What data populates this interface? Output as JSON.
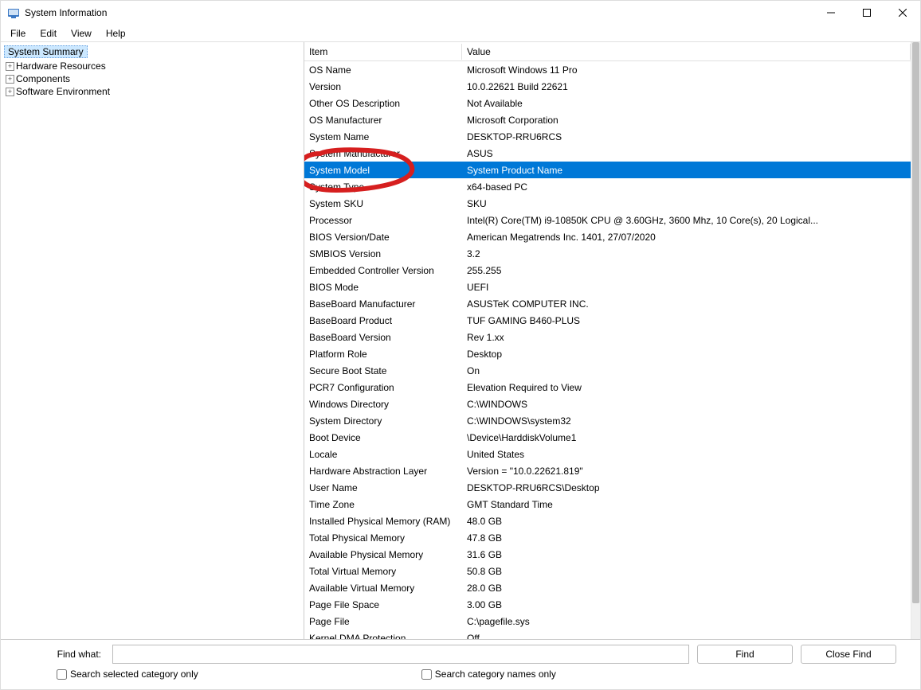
{
  "window": {
    "title": "System Information"
  },
  "menu": {
    "items": [
      "File",
      "Edit",
      "View",
      "Help"
    ]
  },
  "tree": {
    "root": "System Summary",
    "children": [
      "Hardware Resources",
      "Components",
      "Software Environment"
    ]
  },
  "list": {
    "headers": {
      "item": "Item",
      "value": "Value"
    },
    "selected_index": 6,
    "rows": [
      {
        "item": "OS Name",
        "value": "Microsoft Windows 11 Pro"
      },
      {
        "item": "Version",
        "value": "10.0.22621 Build 22621"
      },
      {
        "item": "Other OS Description",
        "value": "Not Available"
      },
      {
        "item": "OS Manufacturer",
        "value": "Microsoft Corporation"
      },
      {
        "item": "System Name",
        "value": "DESKTOP-RRU6RCS"
      },
      {
        "item": "System Manufacturer",
        "value": "ASUS"
      },
      {
        "item": "System Model",
        "value": "System Product Name"
      },
      {
        "item": "System Type",
        "value": "x64-based PC"
      },
      {
        "item": "System SKU",
        "value": "SKU"
      },
      {
        "item": "Processor",
        "value": "Intel(R) Core(TM) i9-10850K CPU @ 3.60GHz, 3600 Mhz, 10 Core(s), 20 Logical..."
      },
      {
        "item": "BIOS Version/Date",
        "value": "American Megatrends Inc. 1401, 27/07/2020"
      },
      {
        "item": "SMBIOS Version",
        "value": "3.2"
      },
      {
        "item": "Embedded Controller Version",
        "value": "255.255"
      },
      {
        "item": "BIOS Mode",
        "value": "UEFI"
      },
      {
        "item": "BaseBoard Manufacturer",
        "value": "ASUSTeK COMPUTER INC."
      },
      {
        "item": "BaseBoard Product",
        "value": "TUF GAMING B460-PLUS"
      },
      {
        "item": "BaseBoard Version",
        "value": "Rev 1.xx"
      },
      {
        "item": "Platform Role",
        "value": "Desktop"
      },
      {
        "item": "Secure Boot State",
        "value": "On"
      },
      {
        "item": "PCR7 Configuration",
        "value": "Elevation Required to View"
      },
      {
        "item": "Windows Directory",
        "value": "C:\\WINDOWS"
      },
      {
        "item": "System Directory",
        "value": "C:\\WINDOWS\\system32"
      },
      {
        "item": "Boot Device",
        "value": "\\Device\\HarddiskVolume1"
      },
      {
        "item": "Locale",
        "value": "United States"
      },
      {
        "item": "Hardware Abstraction Layer",
        "value": "Version = \"10.0.22621.819\""
      },
      {
        "item": "User Name",
        "value": "DESKTOP-RRU6RCS\\Desktop"
      },
      {
        "item": "Time Zone",
        "value": "GMT Standard Time"
      },
      {
        "item": "Installed Physical Memory (RAM)",
        "value": "48.0 GB"
      },
      {
        "item": "Total Physical Memory",
        "value": "47.8 GB"
      },
      {
        "item": "Available Physical Memory",
        "value": "31.6 GB"
      },
      {
        "item": "Total Virtual Memory",
        "value": "50.8 GB"
      },
      {
        "item": "Available Virtual Memory",
        "value": "28.0 GB"
      },
      {
        "item": "Page File Space",
        "value": "3.00 GB"
      },
      {
        "item": "Page File",
        "value": "C:\\pagefile.sys"
      },
      {
        "item": "Kernel DMA Protection",
        "value": "Off"
      }
    ]
  },
  "find": {
    "label": "Find what:",
    "input_value": "",
    "find_button": "Find",
    "close_button": "Close Find",
    "check1": "Search selected category only",
    "check2": "Search category names only"
  },
  "colors": {
    "selection": "#0078d7",
    "annotation": "#d61f1f"
  }
}
